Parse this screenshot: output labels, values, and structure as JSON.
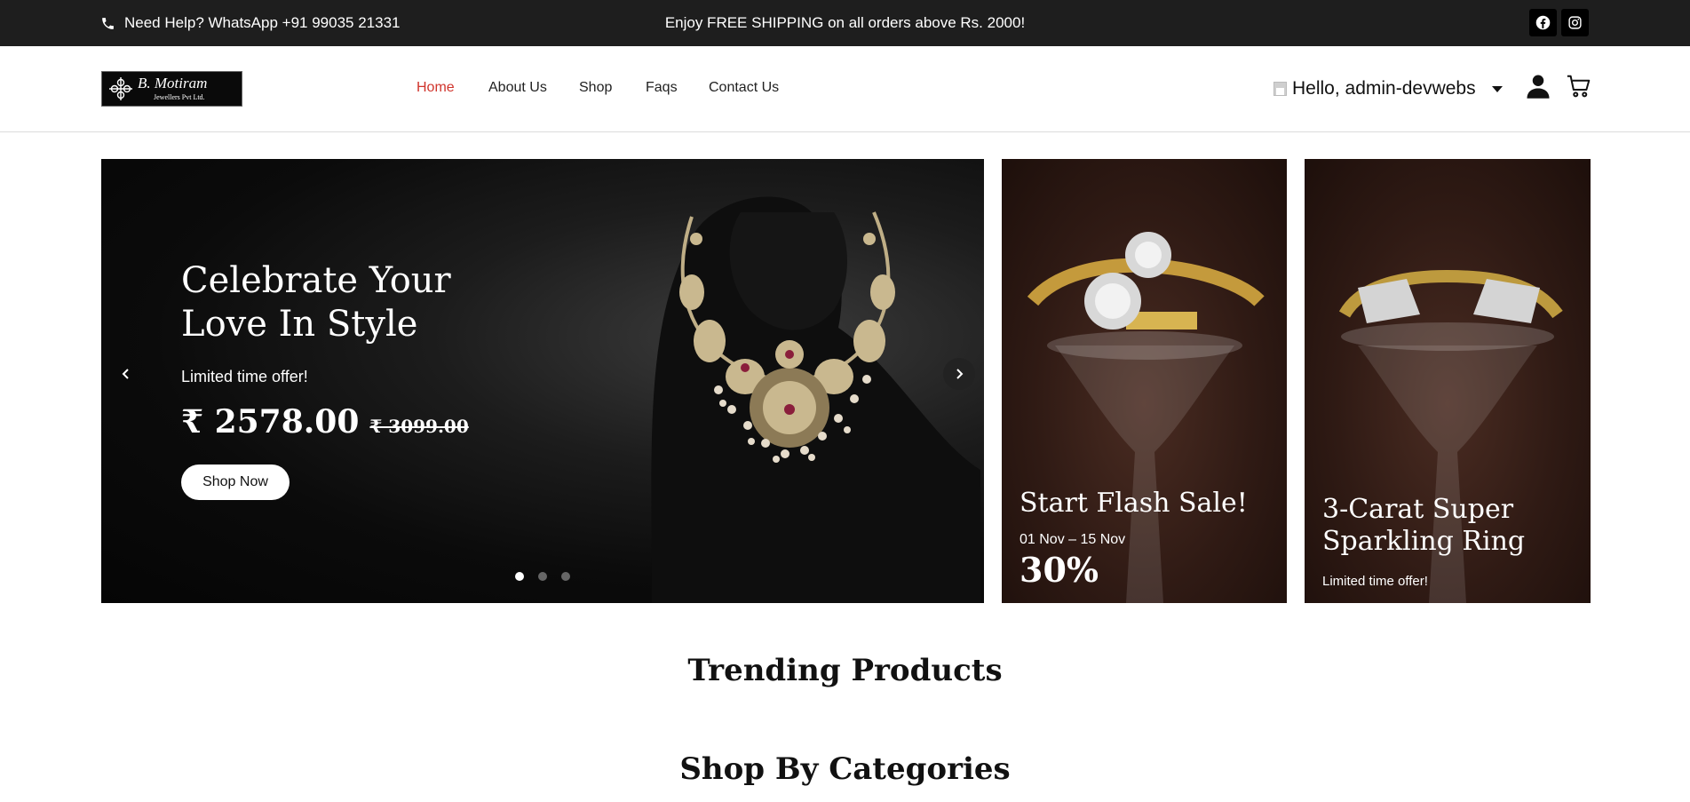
{
  "topbar": {
    "help_text": "Need Help? WhatsApp +91 99035 21331",
    "promo_text": "Enjoy FREE SHIPPING on all orders above Rs. 2000!",
    "social": [
      "facebook-icon",
      "instagram-icon"
    ]
  },
  "header": {
    "logo": {
      "brand": "B. Motiram",
      "sub": "Jewellers Pvt Ltd."
    },
    "nav": [
      {
        "label": "Home",
        "active": true
      },
      {
        "label": "About Us"
      },
      {
        "label": "Shop"
      },
      {
        "label": "Faqs"
      },
      {
        "label": "Contact Us"
      }
    ],
    "greeting": "Hello, admin-devwebs",
    "accent_color": "#d0342c"
  },
  "hero": {
    "title": "Celebrate Your Love In Style",
    "offer": "Limited time offer!",
    "price": "₹ 2578.00",
    "old_price": "₹ 3099.00",
    "button": "Shop Now",
    "slides": 3,
    "active_slide": 1
  },
  "promos": [
    {
      "title": "Start Flash Sale!",
      "dates": "01 Nov – 15 Nov",
      "discount": "30%"
    },
    {
      "title": "3-Carat Super Sparkling Ring",
      "offer": "Limited time offer!"
    }
  ],
  "sections": {
    "trending": "Trending Products",
    "categories": "Shop By Categories"
  }
}
